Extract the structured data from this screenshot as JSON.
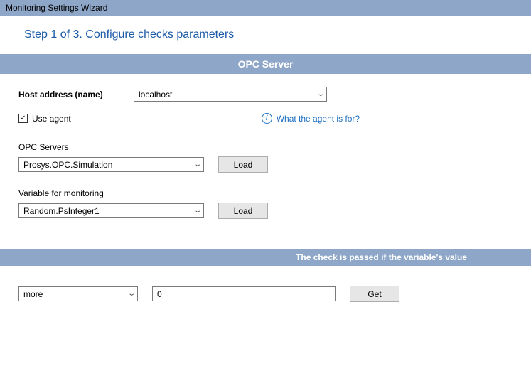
{
  "window": {
    "title": "Monitoring Settings Wizard"
  },
  "step": {
    "heading": "Step 1 of 3. Configure checks parameters"
  },
  "section1": {
    "title": "OPC Server"
  },
  "host": {
    "label": "Host address (name)",
    "value": "localhost"
  },
  "agent": {
    "checkbox_label": "Use agent",
    "checked": true,
    "help_text": "What the agent is for?"
  },
  "servers": {
    "label": "OPC Servers",
    "value": "Prosys.OPC.Simulation",
    "load_label": "Load"
  },
  "variable": {
    "label": "Variable for monitoring",
    "value": "Random.PsInteger1",
    "load_label": "Load"
  },
  "condition": {
    "bar_text": "The check is passed if the variable's value",
    "operator": "more",
    "value": "0",
    "get_label": "Get"
  }
}
